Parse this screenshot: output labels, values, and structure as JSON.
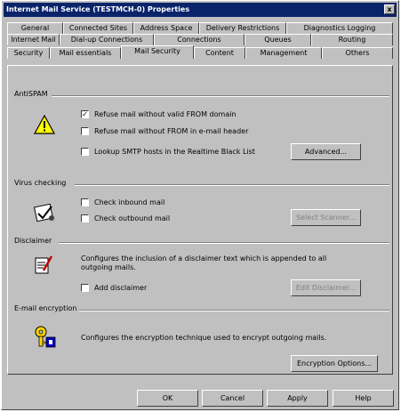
{
  "window": {
    "title": "Internet Mail Service (TESTMCH-0) Properties",
    "close": "x"
  },
  "tabs": {
    "row1": [
      "General",
      "Connected Sites",
      "Address Space",
      "Delivery Restrictions",
      "Diagnostics Logging"
    ],
    "row2": [
      "Internet Mail",
      "Dial-up Connections",
      "Connections",
      "Queues",
      "Routing"
    ],
    "row3": [
      "Security",
      "Mail essentials",
      "Mail Security",
      "Content",
      "Management",
      "Others"
    ]
  },
  "antispam": {
    "title": "AntiSPAM",
    "refuse_from_domain": "Refuse mail without valid FROM domain",
    "refuse_from_header": "Refuse mail without FROM in e-mail header",
    "lookup_smtp": "Lookup SMTP hosts in the Realtime Black List",
    "advanced_button": "Advanced..."
  },
  "virus": {
    "title": "Virus checking",
    "check_inbound": "Check inbound mail",
    "check_outbound": "Check outbound mail",
    "select_scanner_button": "Select Scanner..."
  },
  "disclaimer": {
    "title": "Disclaimer",
    "description": "Configures the inclusion of a disclaimer text which is appended to all outgoing mails.",
    "add_disclaimer": "Add disclaimer",
    "edit_button": "Edit Disclaimer..."
  },
  "encryption": {
    "title": "E-mail encryption",
    "description": "Configures the encryption technique used to encrypt outgoing mails.",
    "options_button": "Encryption Options..."
  },
  "footer": {
    "ok": "OK",
    "cancel": "Cancel",
    "apply": "Apply",
    "help": "Help"
  },
  "icons": {
    "warning": "warning-icon",
    "virus": "virus-check-icon",
    "disclaimer": "disclaimer-edit-icon",
    "encryption": "encryption-key-icon"
  }
}
